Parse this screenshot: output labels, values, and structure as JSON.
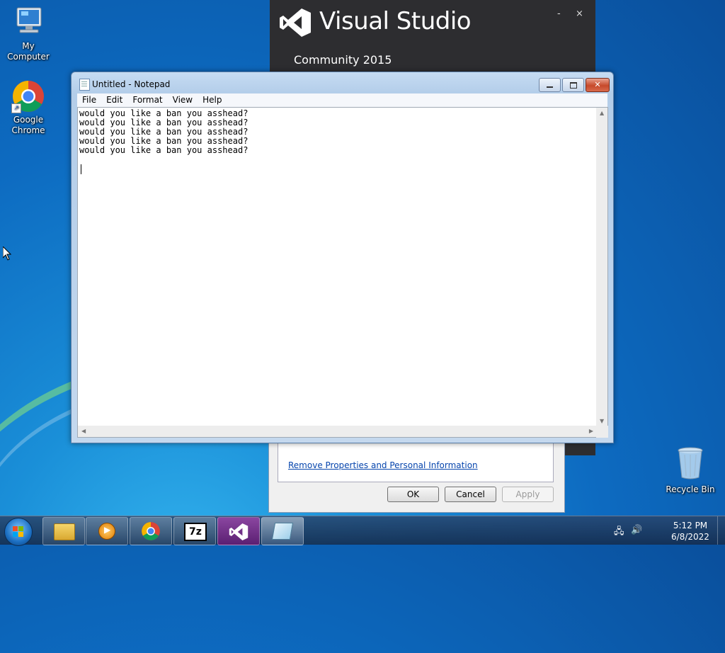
{
  "desktop": {
    "icons": [
      {
        "label": "My Computer",
        "icon": "computer-icon"
      },
      {
        "label": "Google Chrome",
        "icon": "chrome-icon"
      },
      {
        "label": "Recycle Bin",
        "icon": "recycle-bin-icon"
      }
    ]
  },
  "vs_splash": {
    "title": "Visual Studio",
    "edition": "Community 2015",
    "minimize": "-",
    "close": "×"
  },
  "properties_dialog": {
    "link": "Remove Properties and Personal Information",
    "ok": "OK",
    "cancel": "Cancel",
    "apply": "Apply"
  },
  "notepad": {
    "title": "Untitled - Notepad",
    "menu": [
      "File",
      "Edit",
      "Format",
      "View",
      "Help"
    ],
    "content": "would you like a ban you asshead?\nwould you like a ban you asshead?\nwould you like a ban you asshead?\nwould you like a ban you asshead?\nwould you like a ban you asshead?\n\n"
  },
  "taskbar": {
    "apps": [
      "windows-explorer-icon",
      "media-player-icon",
      "chrome-icon",
      "7zip-icon",
      "visual-studio-icon",
      "notepad-icon"
    ],
    "sevenzip_label": "7z",
    "clock_time": "5:12 PM",
    "clock_date": "6/8/2022"
  },
  "colors": {
    "vs_purple": "#68217a",
    "desktop_blue": "#0d6bc1",
    "close_red": "#c64a2b"
  }
}
